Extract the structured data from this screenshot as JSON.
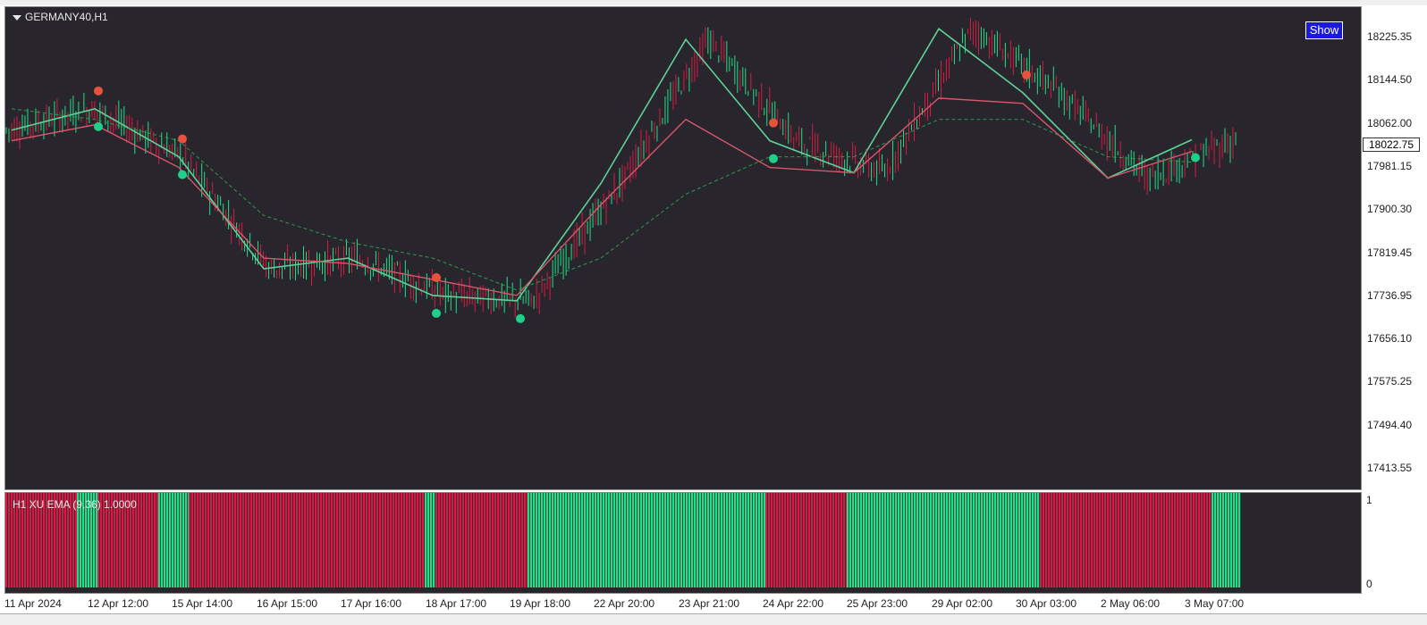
{
  "chart": {
    "title": "GERMANY40,H1",
    "show_button": "Show",
    "price_levels": [
      "18225.35",
      "18144.50",
      "18062.00",
      "17981.15",
      "17900.30",
      "17819.45",
      "17736.95",
      "17656.10",
      "17575.25",
      "17494.40",
      "17413.55"
    ],
    "current_price": "18022.75",
    "colors": {
      "background": "#28252c",
      "bull": "#1fe08a",
      "bear": "#d51c45",
      "ema_fast": "#5fd19a",
      "ema_slow": "#d8576c"
    }
  },
  "indicator": {
    "label": "H1 XU EMA (9,36) 1.0000",
    "axis_top": "1",
    "axis_bottom": "0"
  },
  "time_axis": [
    "11 Apr 2024",
    "12 Apr 12:00",
    "15 Apr 14:00",
    "16 Apr 15:00",
    "17 Apr 16:00",
    "18 Apr 17:00",
    "19 Apr 18:00",
    "22 Apr 20:00",
    "23 Apr 21:00",
    "24 Apr 22:00",
    "25 Apr 23:00",
    "29 Apr 02:00",
    "30 Apr 03:00",
    "2 May 06:00",
    "3 May 07:00"
  ],
  "chart_data": {
    "type": "line",
    "title": "GERMANY40,H1",
    "x": [
      "11 Apr 2024",
      "12 Apr 12:00",
      "15 Apr 14:00",
      "16 Apr 15:00",
      "17 Apr 16:00",
      "18 Apr 17:00",
      "19 Apr 18:00",
      "22 Apr 20:00",
      "23 Apr 21:00",
      "24 Apr 22:00",
      "25 Apr 23:00",
      "29 Apr 02:00",
      "30 Apr 03:00",
      "2 May 06:00",
      "3 May 07:00"
    ],
    "ylim": [
      17400,
      18260
    ],
    "series": [
      {
        "values": [
          18040,
          18080,
          17990,
          17780,
          17800,
          17730,
          17720,
          17940,
          18210,
          18020,
          17960,
          18230,
          18110,
          17950,
          18022
        ]
      },
      {
        "values": [
          18020,
          18050,
          17970,
          17800,
          17790,
          17760,
          17730,
          17900,
          18060,
          17970,
          17960,
          18100,
          18090,
          17950,
          18000
        ]
      },
      {
        "values": [
          18080,
          18060,
          18020,
          17880,
          17830,
          17800,
          17740,
          17800,
          17920,
          17990,
          17990,
          18060,
          18060,
          17990,
          17980
        ]
      }
    ],
    "indicator_segments": [
      {
        "state": "bear",
        "end": "12 Apr 12:00"
      },
      {
        "state": "bull",
        "end": "12 Apr 12:00"
      },
      {
        "state": "bear",
        "end": "15 Apr 14:00"
      },
      {
        "state": "bull",
        "end": "15 Apr 14:00"
      },
      {
        "state": "bear",
        "end": "18 Apr 17:00"
      },
      {
        "state": "bull",
        "end": "18 Apr 17:00"
      },
      {
        "state": "bear",
        "end": "19 Apr 18:00"
      },
      {
        "state": "bull",
        "end": "24 Apr 22:00"
      },
      {
        "state": "bear",
        "end": "25 Apr 23:00"
      },
      {
        "state": "bull",
        "end": "30 Apr 03:00"
      },
      {
        "state": "bear",
        "end": "3 May 07:00"
      },
      {
        "state": "bull",
        "end": "3 May 07:00"
      }
    ]
  }
}
